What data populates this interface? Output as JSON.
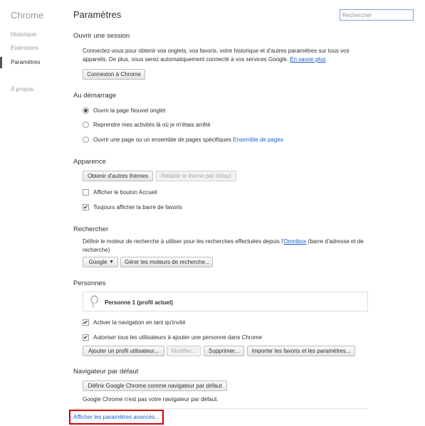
{
  "sidebar": {
    "title": "Chrome",
    "items": [
      {
        "label": "Historique"
      },
      {
        "label": "Extensions"
      },
      {
        "label": "Paramètres"
      },
      {
        "label": "À propos"
      }
    ]
  },
  "header": {
    "title": "Paramètres",
    "search_placeholder": "Rechercher"
  },
  "signin": {
    "title": "Ouvrir une session",
    "text_line1": "Connectez-vous pour obtenir vos onglets, vos favoris, votre historique et d'autres paramètres sur tous vos",
    "text_line2": "appareils. De plus, vous serez automatiquement connecté à vos services Google.",
    "learn_more": "En savoir plus",
    "button": "Connexion à Chrome"
  },
  "startup": {
    "title": "Au démarrage",
    "options": [
      {
        "label": "Ouvrir la page Nouvel onglet",
        "selected": true
      },
      {
        "label": "Reprendre mes activités là où je m'étais arrêté",
        "selected": false
      },
      {
        "label": "Ouvrir une page ou un ensemble de pages spécifiques",
        "selected": false
      }
    ],
    "pages_link": "Ensemble de pages"
  },
  "appearance": {
    "title": "Apparence",
    "get_themes": "Obtenir d'autres thèmes",
    "reset_theme": "Rétablir le thème par défaut",
    "show_home": {
      "label": "Afficher le bouton Accueil",
      "checked": false
    },
    "show_bookmarks": {
      "label": "Toujours afficher la barre de favoris",
      "checked": true
    }
  },
  "search": {
    "title": "Rechercher",
    "text_line1_prefix": "Définir le moteur de recherche à utiliser pour les recherches effectuées depuis l'",
    "omnibox": "Omnibox",
    "text_line1_suffix": " (barre d'adresse et de",
    "text_line2": "recherche)",
    "engine": "Google",
    "manage": "Gérer les moteurs de recherche..."
  },
  "people": {
    "title": "Personnes",
    "profile": "Personne 1 (profil actuel)",
    "guest": {
      "label": "Activer la navigation en tant qu'invité",
      "checked": true
    },
    "allow_add": {
      "label": "Autoriser tous les utilisateurs à ajouter une personne dans Chrome",
      "checked": true
    },
    "add_btn": "Ajouter un profil utilisateur...",
    "edit_btn": "Modifier...",
    "delete_btn": "Supprimer...",
    "import_btn": "Importer les favoris et les paramètres..."
  },
  "default_browser": {
    "title": "Navigateur par défaut",
    "button": "Définir Google Chrome comme navigateur par défaut",
    "status": "Google Chrome n'est pas votre navigateur par défaut."
  },
  "advanced": {
    "link": "Afficher les paramètres avancés...",
    "highlight_color": "#d00000"
  },
  "colors": {
    "link": "#1b5fcf",
    "search_border": "#6fa7e6"
  }
}
